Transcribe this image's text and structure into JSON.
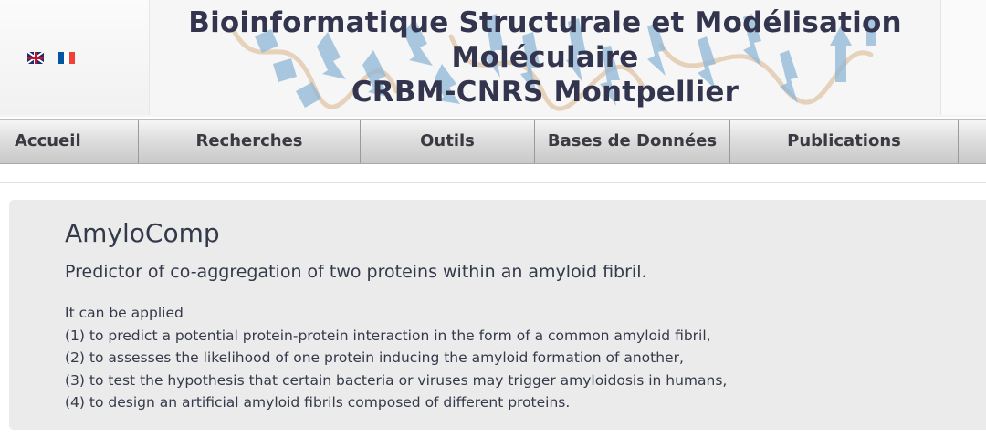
{
  "header": {
    "title_line1": "Bioinformatique Structurale et Modélisation",
    "title_line2": "Moléculaire",
    "title_line3": "CRBM-CNRS Montpellier",
    "languages": [
      {
        "name": "english-flag",
        "colors": [
          "#1b2f6e",
          "#ffffff",
          "#c8102e"
        ]
      },
      {
        "name": "french-flag",
        "colors": [
          "#0055a4",
          "#ffffff",
          "#ef4135"
        ]
      }
    ]
  },
  "nav": {
    "items": [
      {
        "label": "Accueil"
      },
      {
        "label": "Recherches"
      },
      {
        "label": "Outils"
      },
      {
        "label": "Bases de Données"
      },
      {
        "label": "Publications"
      }
    ]
  },
  "main": {
    "title": "AmyloComp",
    "subtitle": "Predictor of co-aggregation of two proteins within an amyloid fibril.",
    "description": [
      "It can be applied",
      "(1) to predict a potential protein-protein interaction in the form of a common amyloid fibril,",
      "(2) to assesses the likelihood of one protein inducing the amyloid formation of another,",
      "(3) to test the hypothesis that certain bacteria or viruses may trigger amyloidosis in humans,",
      "(4) to design an artificial amyloid fibrils composed of different proteins."
    ]
  },
  "colors": {
    "title_text": "#33354e",
    "banner_protein": "#8fb8d8",
    "banner_strand": "#d8b48a",
    "content_bg": "#ebebeb"
  }
}
